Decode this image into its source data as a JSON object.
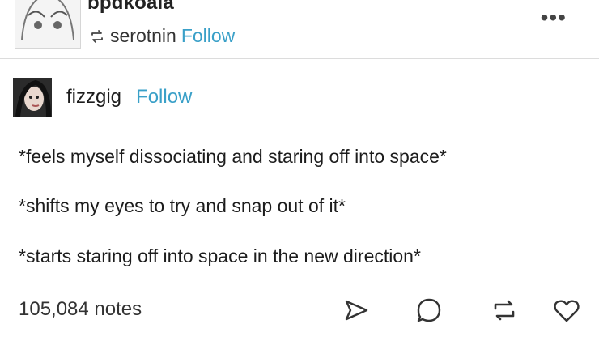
{
  "post": {
    "reblogger_username": "bpdkoala",
    "reblogged_from": "serotnin",
    "reblogged_from_follow": "Follow",
    "more_icon": "more-dots-icon",
    "more_label": "•••"
  },
  "original": {
    "username": "fizzgig",
    "follow": "Follow",
    "lines": [
      "*feels myself dissociating and staring off into space*",
      "*shifts my eyes to try and snap out of it*",
      "*starts staring off into space in the new direction*"
    ]
  },
  "footer": {
    "notes": "105,084 notes",
    "actions": [
      "share-icon",
      "reply-icon",
      "reblog-icon",
      "like-icon"
    ]
  },
  "colors": {
    "accent": "#3aa0c8",
    "text": "#1c1c1c",
    "divider": "#dcdcdc"
  }
}
